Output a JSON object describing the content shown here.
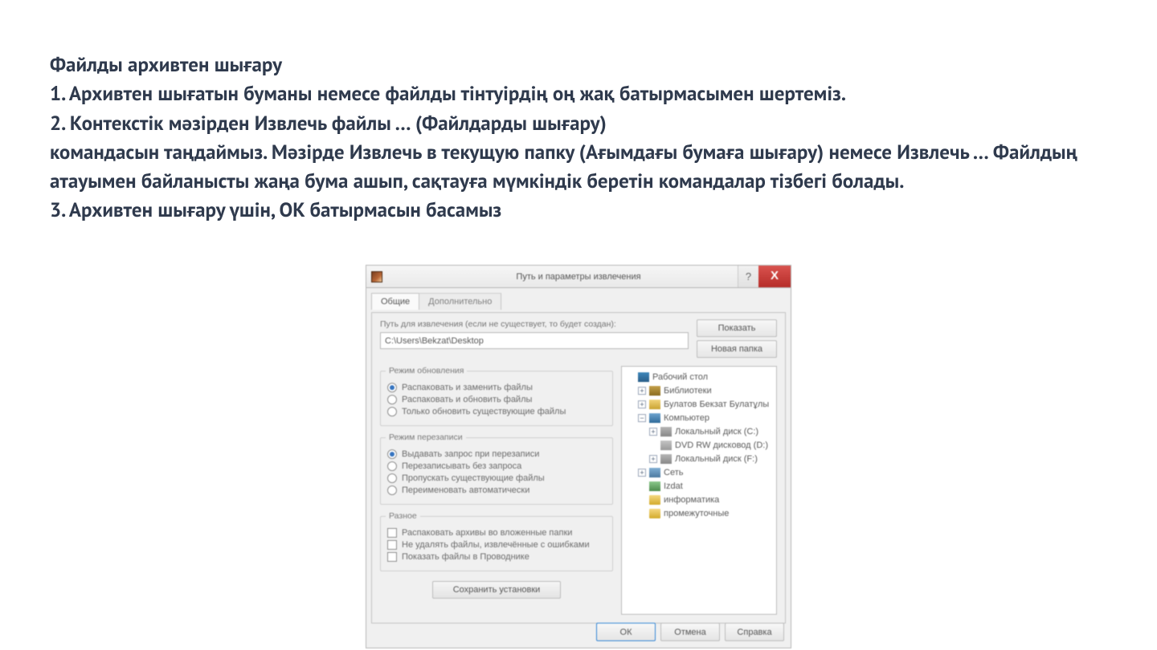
{
  "doc": {
    "heading": "Файлды архивтен шығару",
    "p1": "1. Архивтен шығатын буманы немесе файлды тінтуірдің оң жақ батырмасымен шертеміз.",
    "p2": "2. Контекстік мәзірден Извлечь файлы … (Файлдарды шығару)",
    "p3": "командасын таңдаймыз. Мәзірде Извлечь в текущую папку (Ағымдағы бумаға шығару) немесе Извлечь … Файлдың атауымен байланысты жаңа бума ашып, сақтауға мүмкіндік беретін командалар тізбегі болады.",
    "p4": "3. Архивтен шығару үшін, ОК батырмасын басамыз"
  },
  "dialog": {
    "title": "Путь и параметры извлечения",
    "help_symbol": "?",
    "close_symbol": "X",
    "tabs": {
      "general": "Общие",
      "advanced": "Дополнительно"
    },
    "path_caption": "Путь для извлечения (если не существует, то будет создан):",
    "path_value": "C:\\Users\\Bekzat\\Desktop",
    "side_buttons": {
      "show": "Показать",
      "new_folder": "Новая папка"
    },
    "update_group": {
      "legend": "Режим обновления",
      "r1": "Распаковать и заменить файлы",
      "r2": "Распаковать и обновить файлы",
      "r3": "Только обновить существующие файлы",
      "selected": "r1"
    },
    "overwrite_group": {
      "legend": "Режим перезаписи",
      "r1": "Выдавать запрос при перезаписи",
      "r2": "Перезаписывать без запроса",
      "r3": "Пропускать существующие файлы",
      "r4": "Переименовать автоматически",
      "selected": "r1"
    },
    "misc_group": {
      "legend": "Разное",
      "c1": "Распаковать архивы во вложенные папки",
      "c2": "Не удалять файлы, извлечённые с ошибками",
      "c3": "Показать файлы в Проводнике"
    },
    "save_settings": "Сохранить установки",
    "tree": {
      "n0": "Рабочий стол",
      "n1": "Библиотеки",
      "n2": "Булатов Бекзат Булатұлы",
      "n3": "Компьютер",
      "n4": "Локальный диск (C:)",
      "n5": "DVD RW дисковод (D:)",
      "n6": "Локальный диск (F:)",
      "n7": "Сеть",
      "n8": "Izdat",
      "n9": "информатика",
      "n10": "промежуточные"
    },
    "buttons": {
      "ok": "ОК",
      "cancel": "Отмена",
      "help": "Справка"
    }
  }
}
